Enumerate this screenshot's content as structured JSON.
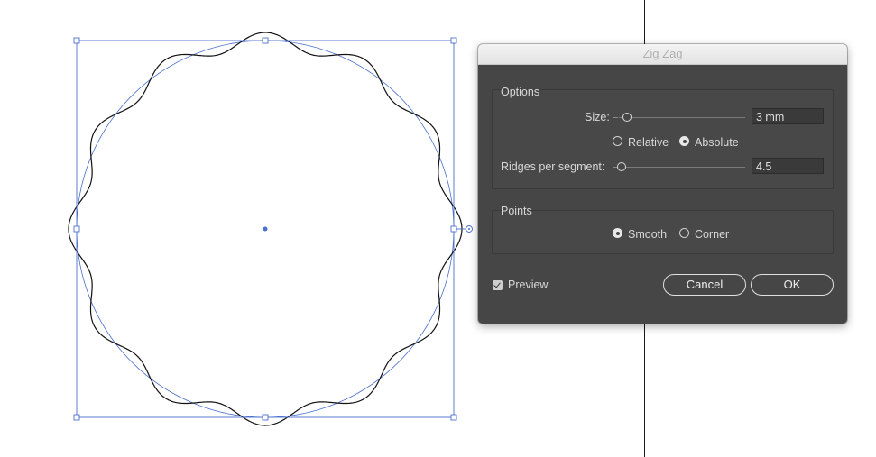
{
  "dialog": {
    "title": "Zig Zag",
    "options": {
      "group_title": "Options",
      "size_label": "Size:",
      "size_value": "3 mm",
      "relative_label": "Relative",
      "absolute_label": "Absolute",
      "selected_mode": "Absolute",
      "ridges_label": "Ridges per segment:",
      "ridges_value": "4.5"
    },
    "points": {
      "group_title": "Points",
      "smooth_label": "Smooth",
      "corner_label": "Corner",
      "selected": "Smooth"
    },
    "preview_label": "Preview",
    "preview_checked": true,
    "cancel_label": "Cancel",
    "ok_label": "OK"
  },
  "colors": {
    "selection_blue": "#4a6fcc",
    "dialog_bg": "#464646",
    "path_black": "#111111"
  }
}
